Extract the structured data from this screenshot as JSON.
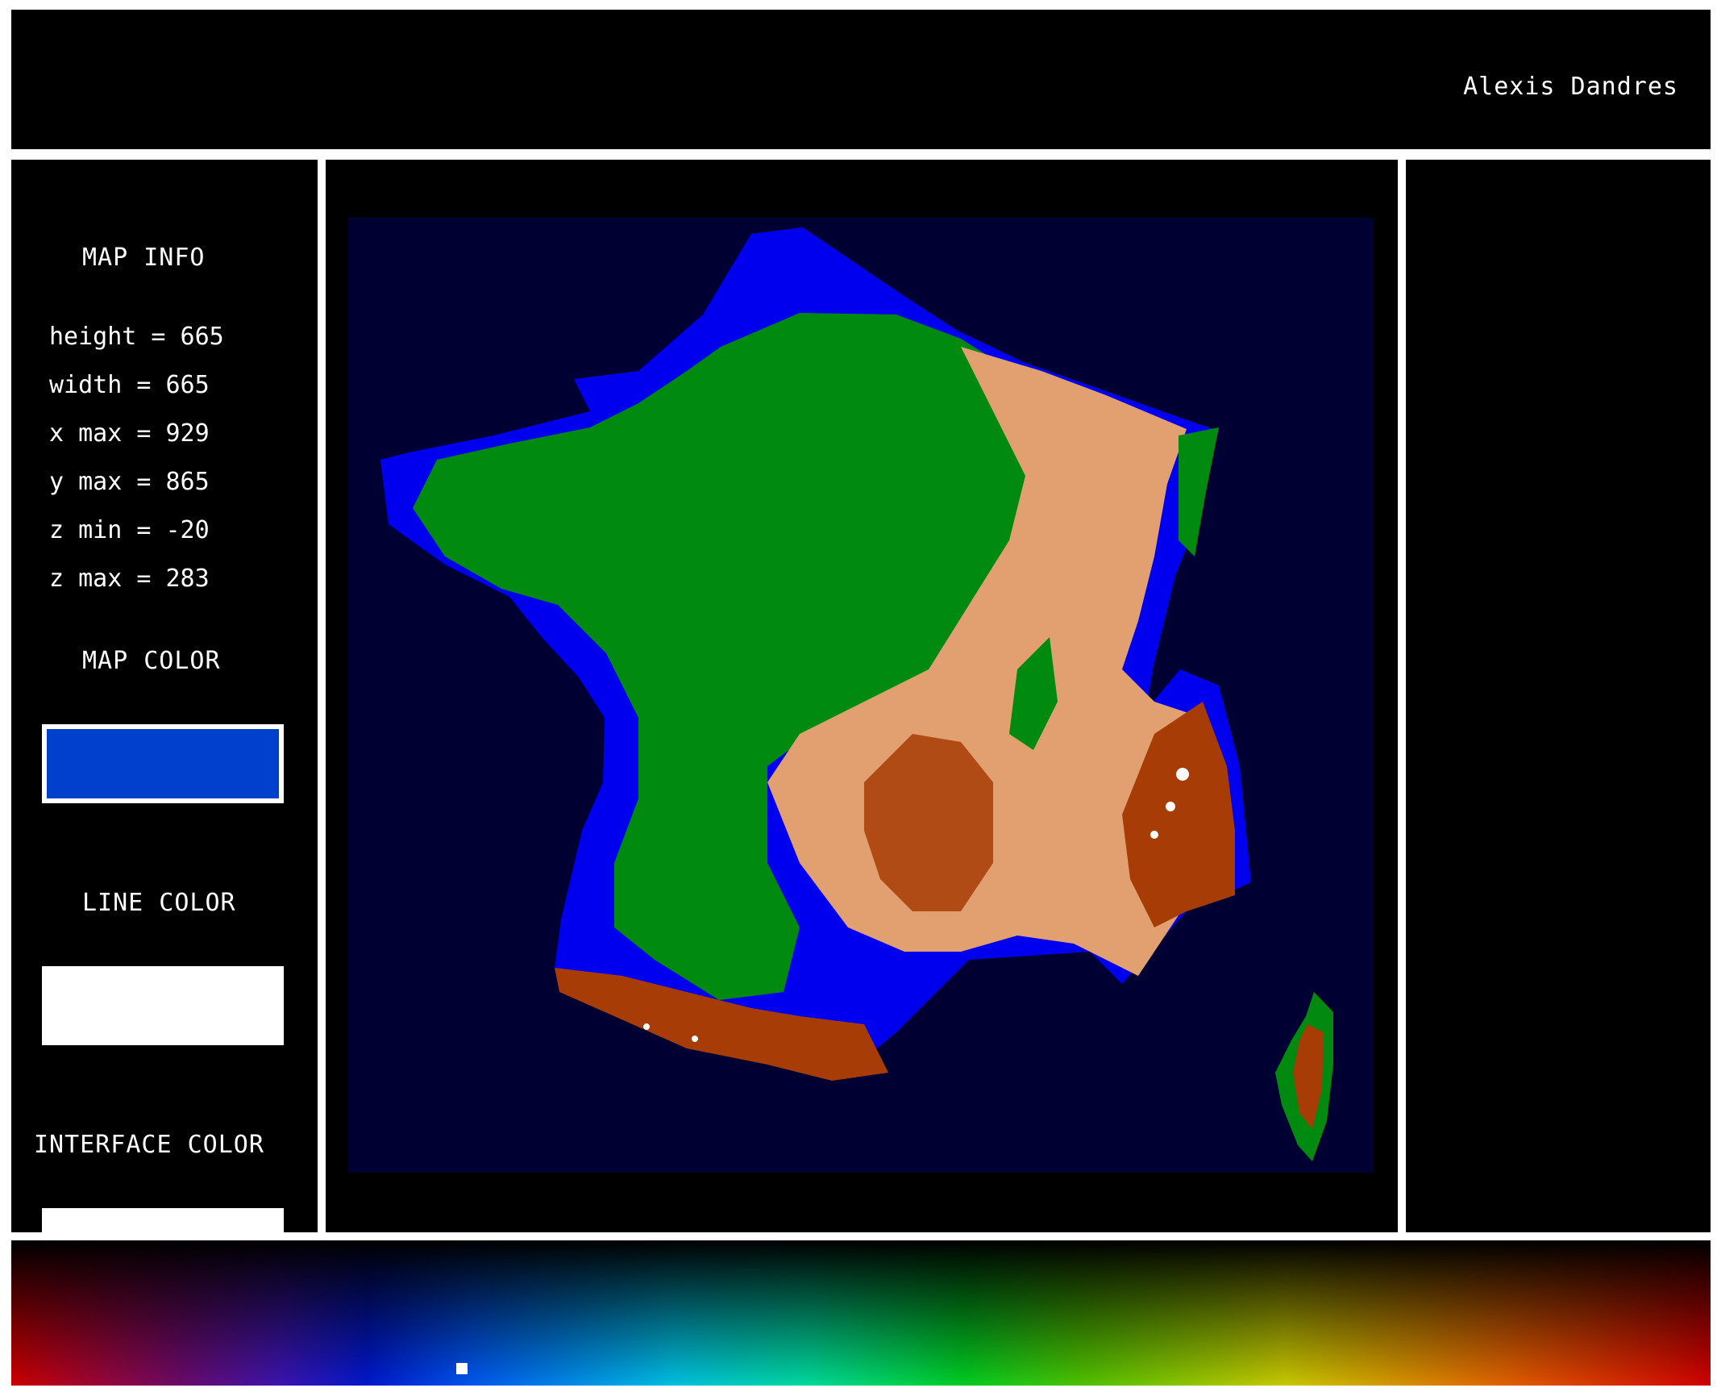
{
  "header": {
    "author": "Alexis Dandres"
  },
  "sidebar": {
    "map_info_title": "MAP INFO",
    "info_lines": [
      "height = 665",
      "width = 665",
      "x max = 929",
      "y max = 865",
      "z min = -20",
      "z max = 283"
    ],
    "map_color_title": "MAP COLOR",
    "map_color": "#0040cc",
    "line_color_title": "LINE COLOR",
    "line_color": "#ffffff",
    "interface_color_title": "INTERFACE COLOR",
    "interface_color": "#ffffff"
  },
  "map": {
    "background_color": "#000033",
    "colors": {
      "water": "#0000ee",
      "lowland": "#008a10",
      "highland": "#e2a070",
      "mountain": "#a83c06",
      "peak": "#ffffff"
    }
  },
  "palette": {
    "marker_fraction": 0.265
  }
}
